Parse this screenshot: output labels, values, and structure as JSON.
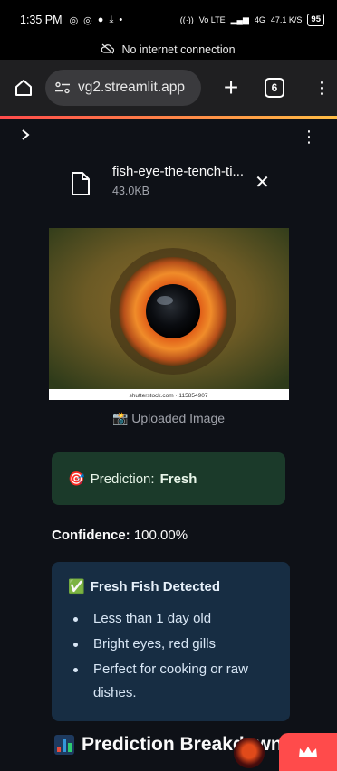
{
  "status_bar": {
    "time": "1:35 PM",
    "signal_text": "Vo LTE",
    "network_text": "4G",
    "speed": "47.1 K/S",
    "battery": "95"
  },
  "connection_banner": "No internet connection",
  "browser": {
    "url": "vg2.streamlit.app",
    "tab_count": "6"
  },
  "uploader": {
    "file_name": "fish-eye-the-tench-ti...",
    "file_size": "43.0KB"
  },
  "image": {
    "watermark": "shutterstock.com · 115854907",
    "caption": "📸 Uploaded Image"
  },
  "prediction": {
    "icon": "🎯",
    "label": "Prediction:",
    "value": "Fresh"
  },
  "confidence": {
    "label": "Confidence:",
    "value": "100.00%"
  },
  "info": {
    "icon": "✅",
    "title": "Fresh Fish Detected",
    "items": [
      "Less than 1 day old",
      "Bright eyes, red gills",
      "Perfect for cooking or raw dishes."
    ]
  },
  "section_title": "Prediction Breakdown",
  "colors": {
    "accent": "#ff4b4b",
    "success_bg": "#1b3a2a",
    "info_bg": "#172d43",
    "app_bg": "#0e1117"
  }
}
